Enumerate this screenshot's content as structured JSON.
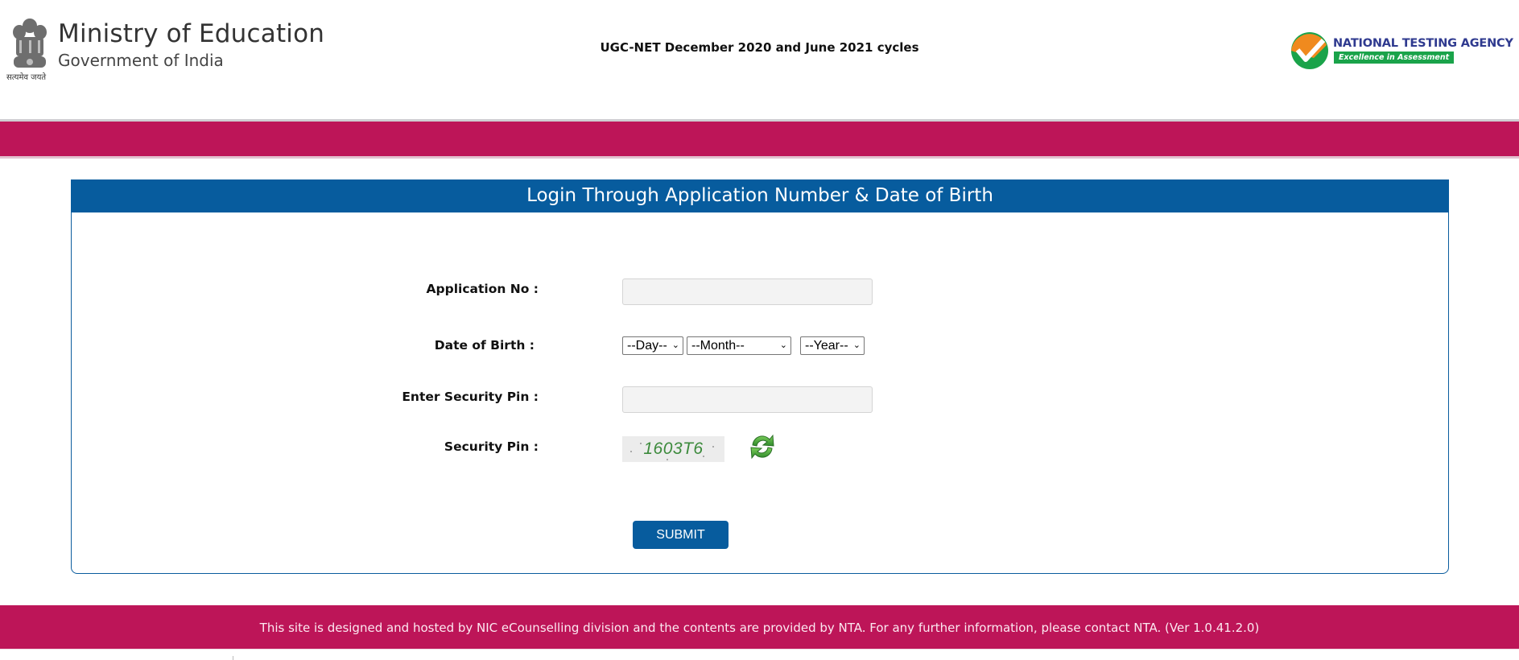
{
  "header": {
    "ministry_title": "Ministry of Education",
    "ministry_subtitle": "Government of India",
    "emblem_caption": "सत्यमेव जयते",
    "exam_title": "UGC-NET December 2020 and June 2021 cycles",
    "agency_name": "NATIONAL TESTING AGENCY",
    "agency_tagline": "Excellence in Assessment"
  },
  "login": {
    "title": "Login Through Application Number & Date of Birth",
    "application_no": {
      "label": "Application No :",
      "value": "",
      "placeholder": ""
    },
    "dob": {
      "label": "Date of Birth :",
      "day": "--Day--",
      "month": "--Month--",
      "year": "--Year--"
    },
    "security_pin_input": {
      "label": "Enter Security Pin :",
      "value": "",
      "placeholder": ""
    },
    "security_pin": {
      "label": "Security Pin :",
      "captcha_text": "1603T6"
    },
    "submit_label": "SUBMIT"
  },
  "footer": {
    "text": "This site is designed and hosted by NIC eCounselling division and the contents are provided by NTA. For any further information, please contact NTA. (Ver 1.0.41.2.0)"
  },
  "colors": {
    "brand_pink": "#bd1558",
    "brand_blue": "#075c9e",
    "captcha_green": "#3c8a3c",
    "nta_navy": "#2f3a8f",
    "nta_green": "#1aa34a",
    "nta_orange": "#f08a1e"
  },
  "icons": {
    "emblem": "national-emblem-icon",
    "nta_logo": "nta-checkmark-logo",
    "refresh": "refresh-icon",
    "dropdown": "chevron-down-icon"
  }
}
